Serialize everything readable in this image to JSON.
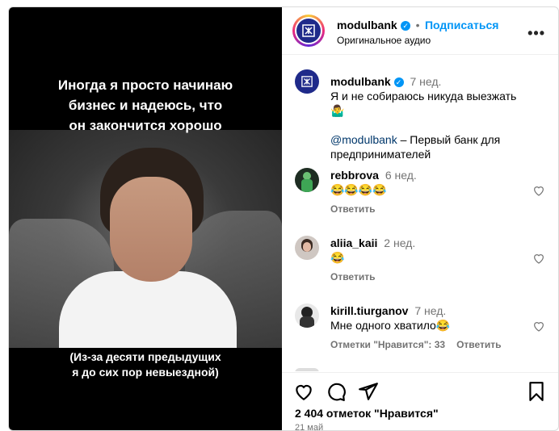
{
  "media": {
    "caption_top": "Иногда я просто начинаю\nбизнес и надеюсь, что\nон закончится хорошо",
    "caption_bottom": "(Из-за десяти предыдущих\nя до сих пор невыездной)"
  },
  "header": {
    "username": "modulbank",
    "follow_label": "Подписаться",
    "subtitle": "Оригинальное аудио",
    "more_label": "•••"
  },
  "post": {
    "username": "modulbank",
    "time": "7 нед.",
    "text": "Я и не собираюсь никуда выезжать🤷‍♂️",
    "mention": "@modulbank",
    "text2": " – Первый банк для предпринимателей"
  },
  "comments": [
    {
      "username": "rebbrova",
      "time": "6 нед.",
      "text": "😂😂😂😂",
      "reply_label": "Ответить",
      "likes_label": ""
    },
    {
      "username": "aliia_kaii",
      "time": "2 нед.",
      "text": "😂",
      "reply_label": "Ответить",
      "likes_label": ""
    },
    {
      "username": "kirill.tiurganov",
      "time": "7 нед.",
      "text": "Мне одного хватило😂",
      "reply_label": "Ответить",
      "likes_label": "Отметки \"Нравится\": 33"
    }
  ],
  "footer": {
    "likes": "2 404 отметок \"Нравится\"",
    "date": "21 май"
  },
  "colors": {
    "accent": "#0095f6",
    "logo_bg": "#1f2a8a",
    "muted": "#737373"
  },
  "icons": [
    "verified-icon",
    "more-icon",
    "heart-icon",
    "comment-icon",
    "share-icon",
    "bookmark-icon"
  ]
}
